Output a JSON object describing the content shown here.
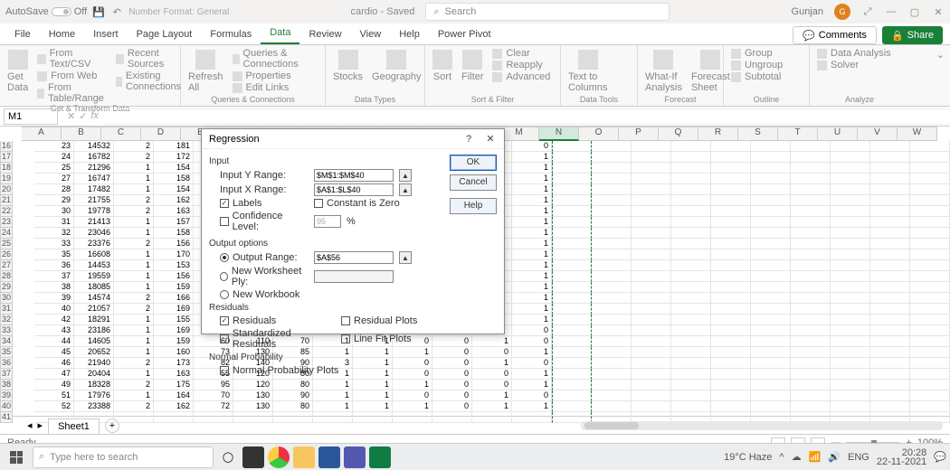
{
  "title": {
    "autosave": "AutoSave",
    "autosave_state": "Off",
    "numfmt": "Number Format: General",
    "filename": "cardio - Saved",
    "search_ph": "Search",
    "user": "Gunjan",
    "avatar": "G"
  },
  "tabs": [
    "File",
    "Home",
    "Insert",
    "Page Layout",
    "Formulas",
    "Data",
    "Review",
    "View",
    "Help",
    "Power Pivot"
  ],
  "active_tab": 5,
  "comments": "Comments",
  "share": "Share",
  "ribbon": {
    "g1": {
      "title": "Get & Transform Data",
      "big": "Get\nData",
      "items": [
        "From Text/CSV",
        "From Web",
        "From Table/Range",
        "Recent Sources",
        "Existing Connections"
      ]
    },
    "g2": {
      "title": "Queries & Connections",
      "big": "Refresh\nAll",
      "items": [
        "Queries & Connections",
        "Properties",
        "Edit Links"
      ]
    },
    "g3": {
      "title": "Data Types",
      "items": [
        "Stocks",
        "Geography"
      ]
    },
    "g4": {
      "title": "Sort & Filter",
      "items": [
        "Sort",
        "Filter",
        "Clear",
        "Reapply",
        "Advanced"
      ]
    },
    "g5": {
      "title": "Data Tools",
      "big": "Text to\nColumns"
    },
    "g6": {
      "title": "Forecast",
      "items": [
        "What-If\nAnalysis",
        "Forecast\nSheet"
      ]
    },
    "g7": {
      "title": "Outline",
      "items": [
        "Group",
        "Ungroup",
        "Subtotal"
      ]
    },
    "g8": {
      "title": "Analyze",
      "items": [
        "Data Analysis",
        "Solver"
      ]
    }
  },
  "namebox": "M1",
  "fx": "",
  "cols": [
    "A",
    "B",
    "C",
    "D",
    "E",
    "F",
    "G",
    "H",
    "I",
    "J",
    "K",
    "L",
    "M",
    "N",
    "O",
    "P",
    "Q",
    "R",
    "S",
    "T",
    "U",
    "V",
    "W"
  ],
  "selcol": 13,
  "rowstart": 16,
  "rows": [
    [
      23,
      14532,
      2,
      181,
      null,
      null,
      null,
      null,
      null,
      null,
      null,
      null,
      0
    ],
    [
      24,
      16782,
      2,
      172,
      null,
      null,
      null,
      null,
      null,
      null,
      null,
      null,
      1
    ],
    [
      25,
      21296,
      1,
      154,
      null,
      null,
      null,
      null,
      null,
      null,
      null,
      null,
      1
    ],
    [
      27,
      16747,
      1,
      158,
      null,
      null,
      null,
      null,
      null,
      null,
      null,
      null,
      1
    ],
    [
      28,
      17482,
      1,
      154,
      null,
      null,
      null,
      null,
      null,
      null,
      null,
      null,
      1
    ],
    [
      29,
      21755,
      2,
      162,
      null,
      null,
      null,
      null,
      null,
      null,
      null,
      null,
      1
    ],
    [
      30,
      19778,
      2,
      163,
      null,
      null,
      null,
      null,
      null,
      null,
      null,
      null,
      1
    ],
    [
      31,
      21413,
      1,
      157,
      null,
      null,
      null,
      null,
      null,
      null,
      null,
      null,
      1
    ],
    [
      32,
      23046,
      1,
      158,
      null,
      null,
      null,
      null,
      null,
      null,
      null,
      null,
      1
    ],
    [
      33,
      23376,
      2,
      156,
      null,
      null,
      null,
      null,
      null,
      null,
      null,
      null,
      1
    ],
    [
      35,
      16608,
      1,
      170,
      null,
      null,
      null,
      null,
      null,
      null,
      null,
      null,
      1
    ],
    [
      36,
      14453,
      1,
      153,
      null,
      null,
      null,
      null,
      null,
      null,
      null,
      null,
      1
    ],
    [
      37,
      19559,
      1,
      156,
      null,
      null,
      null,
      null,
      null,
      null,
      null,
      null,
      1
    ],
    [
      38,
      18085,
      1,
      159,
      null,
      null,
      null,
      null,
      null,
      null,
      null,
      null,
      1
    ],
    [
      39,
      14574,
      2,
      166,
      null,
      null,
      null,
      null,
      null,
      null,
      null,
      null,
      1
    ],
    [
      40,
      21057,
      2,
      169,
      null,
      null,
      null,
      null,
      null,
      null,
      null,
      null,
      1
    ],
    [
      42,
      18291,
      1,
      155,
      null,
      null,
      null,
      null,
      null,
      null,
      null,
      null,
      1
    ],
    [
      43,
      23186,
      1,
      169,
      null,
      null,
      null,
      null,
      null,
      null,
      null,
      null,
      0
    ],
    [
      44,
      14605,
      1,
      159,
      60,
      110,
      70,
      1,
      1,
      0,
      0,
      1,
      0
    ],
    [
      45,
      20652,
      1,
      160,
      73,
      130,
      85,
      1,
      1,
      1,
      0,
      0,
      1
    ],
    [
      46,
      21940,
      2,
      173,
      82,
      140,
      90,
      3,
      1,
      0,
      0,
      1,
      0
    ],
    [
      47,
      20404,
      1,
      163,
      55,
      120,
      80,
      1,
      1,
      0,
      0,
      0,
      1
    ],
    [
      49,
      18328,
      2,
      175,
      95,
      120,
      80,
      1,
      1,
      1,
      0,
      0,
      1
    ],
    [
      51,
      17976,
      1,
      164,
      70,
      130,
      90,
      1,
      1,
      0,
      0,
      1,
      0
    ],
    [
      52,
      23388,
      2,
      162,
      72,
      130,
      80,
      1,
      1,
      1,
      0,
      1,
      1
    ]
  ],
  "dialog": {
    "title": "Regression",
    "ok": "OK",
    "cancel": "Cancel",
    "help": "Help",
    "sec_input": "Input",
    "yrange_lbl": "Input Y Range:",
    "yrange": "$M$1:$M$40",
    "xrange_lbl": "Input X Range:",
    "xrange": "$A$1:$L$40",
    "labels": "Labels",
    "czero": "Constant is Zero",
    "conf": "Confidence Level:",
    "conf_v": "95",
    "conf_pct": "%",
    "sec_output": "Output options",
    "out_range_lbl": "Output Range:",
    "out_range": "$A$56",
    "out_ws": "New Worksheet Ply:",
    "out_wb": "New Workbook",
    "sec_resid": "Residuals",
    "resid": "Residuals",
    "stdresid": "Standardized Residuals",
    "residplots": "Residual Plots",
    "linefit": "Line Fit Plots",
    "sec_np": "Normal Probability",
    "npplots": "Normal Probability Plots"
  },
  "sheet_tab": "Sheet1",
  "status": "Ready",
  "zoom": "100%",
  "taskbar": {
    "search_ph": "Type here to search",
    "weather": "19°C  Haze",
    "lang": "ENG",
    "time": "20:28",
    "date": "22-11-2021"
  }
}
